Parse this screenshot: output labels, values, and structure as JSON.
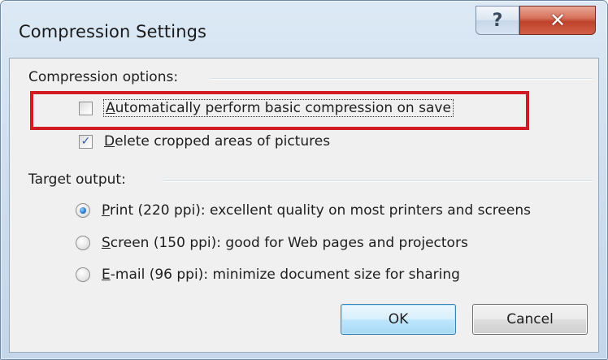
{
  "window": {
    "title": "Compression Settings"
  },
  "caption_buttons": {
    "help_glyph": "?",
    "close_glyph": "✕"
  },
  "compression_options": {
    "header": "Compression options:",
    "auto_compress": {
      "pre": "",
      "accel": "A",
      "post": "utomatically perform basic compression on save",
      "checked": false
    },
    "delete_cropped": {
      "pre": "",
      "accel": "D",
      "post": "elete cropped areas of pictures",
      "checked": true
    }
  },
  "target_output": {
    "header": "Target output:",
    "options": [
      {
        "pre": "",
        "accel": "P",
        "post": "rint (220 ppi): excellent quality on most printers and screens",
        "selected": true
      },
      {
        "pre": "",
        "accel": "S",
        "post": "creen (150 ppi): good for Web pages and projectors",
        "selected": false
      },
      {
        "pre": "",
        "accel": "E",
        "post": "-mail (96 ppi): minimize document size for sharing",
        "selected": false
      }
    ]
  },
  "buttons": {
    "ok": "OK",
    "cancel": "Cancel"
  },
  "colors": {
    "highlight": "#d11a22",
    "close_button": "#c0432c",
    "dialog_face": "#f0f0f0"
  },
  "icons": {
    "help": "question-mark-icon",
    "close": "close-x-icon",
    "check": "checkmark-icon",
    "radio_dot": "radio-dot-icon"
  }
}
